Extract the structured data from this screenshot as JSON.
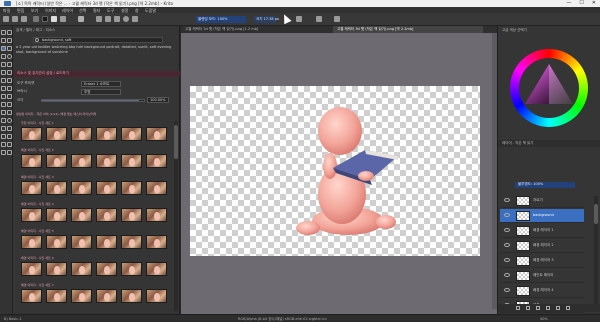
{
  "window": {
    "title": "[소] 목욕 캐릭터 (일반 작은 ... - 고퀄 캐릭터 3d 펫 (작은 책 읽기).png [약 2.2mb] – Krita",
    "controls": [
      "—",
      "☐",
      "✕"
    ]
  },
  "menu": [
    "파일",
    "편집",
    "보기",
    "이미지",
    "레이어",
    "선택",
    "필터",
    "도구",
    "설정",
    "창",
    "도움말"
  ],
  "toolbar": {
    "blend_mode": "블렌딩 모드: 100%",
    "opacity_label": "불투명",
    "opacity_value": "100",
    "size_label": "크기",
    "size_value": "17.38 px"
  },
  "left_panel": {
    "search_tab": "검색",
    "filter_tab": "필터",
    "tabs_line": "검색 / 필터 / 태그 - 리소스",
    "search_value": "background, soft",
    "description": "a 2 year old toddler watching bbq hdri background portrait, detailed, sunlit, soft evening shot, background of sunshine",
    "section_header": "리소스 및 유지관리 설정 / 로드하기",
    "rows": [
      {
        "label": "도구 프리셋",
        "value": "Eraser 1 소프트"
      },
      {
        "label": "브러시",
        "value": "투명"
      }
    ],
    "slider_label": "크기",
    "slider_fraction": 0.95,
    "slider_value": "100.00%",
    "thumbs_header": "생성된 이미지 - 작은 아이 (1/12), 배경 없는 텍스처 라이브러리",
    "thumb_captions": [
      "추천 이미지 - 사진 세트 1",
      "배경 이미지 - 사진 세트 2",
      "배경 이미지 - 사진 세트 3",
      "배경 이미지 - 사진 세트 4",
      "배경 이미지 - 사진 세트 5",
      "배경 이미지 - 사진 세트 6",
      "배경 이미지 - 사진 세트 7"
    ]
  },
  "canvas": {
    "tabs": [
      "고퀄 캐릭터 3d 펫 (작은 책 읽기).png [1.2 mb]",
      "고퀄 캐릭터 3d 펫 (작은 책 읽기).png [약 2.2mb]"
    ]
  },
  "right_panel": {
    "title": "고급 색상 선택기",
    "tabs_title": "레이어 - 작은 책 읽기",
    "blend": "불투명도: 100%",
    "layers": [
      {
        "name": "자르기",
        "selected": false
      },
      {
        "name": "background",
        "selected": true
      },
      {
        "name": "배경 레이어 1",
        "selected": false
      },
      {
        "name": "배경 레이어 2",
        "selected": false
      },
      {
        "name": "배경 레이어 3",
        "selected": false
      },
      {
        "name": "페인트 레이어",
        "selected": false
      },
      {
        "name": "배경 레이어 4",
        "selected": false
      },
      {
        "name": "배경",
        "selected": false
      }
    ]
  },
  "status": {
    "left": "B) Basic-1",
    "center": "RGB/Alpha (8-bit 정수/채널) sRGB-elle-V2-srgbtrc.icc",
    "zoom": "40%"
  },
  "colors": {
    "accent_blue": "#23427a",
    "selection_blue": "#3b6fc1",
    "canvas_bg": "#6e6a72",
    "book": "#5a66a8"
  }
}
